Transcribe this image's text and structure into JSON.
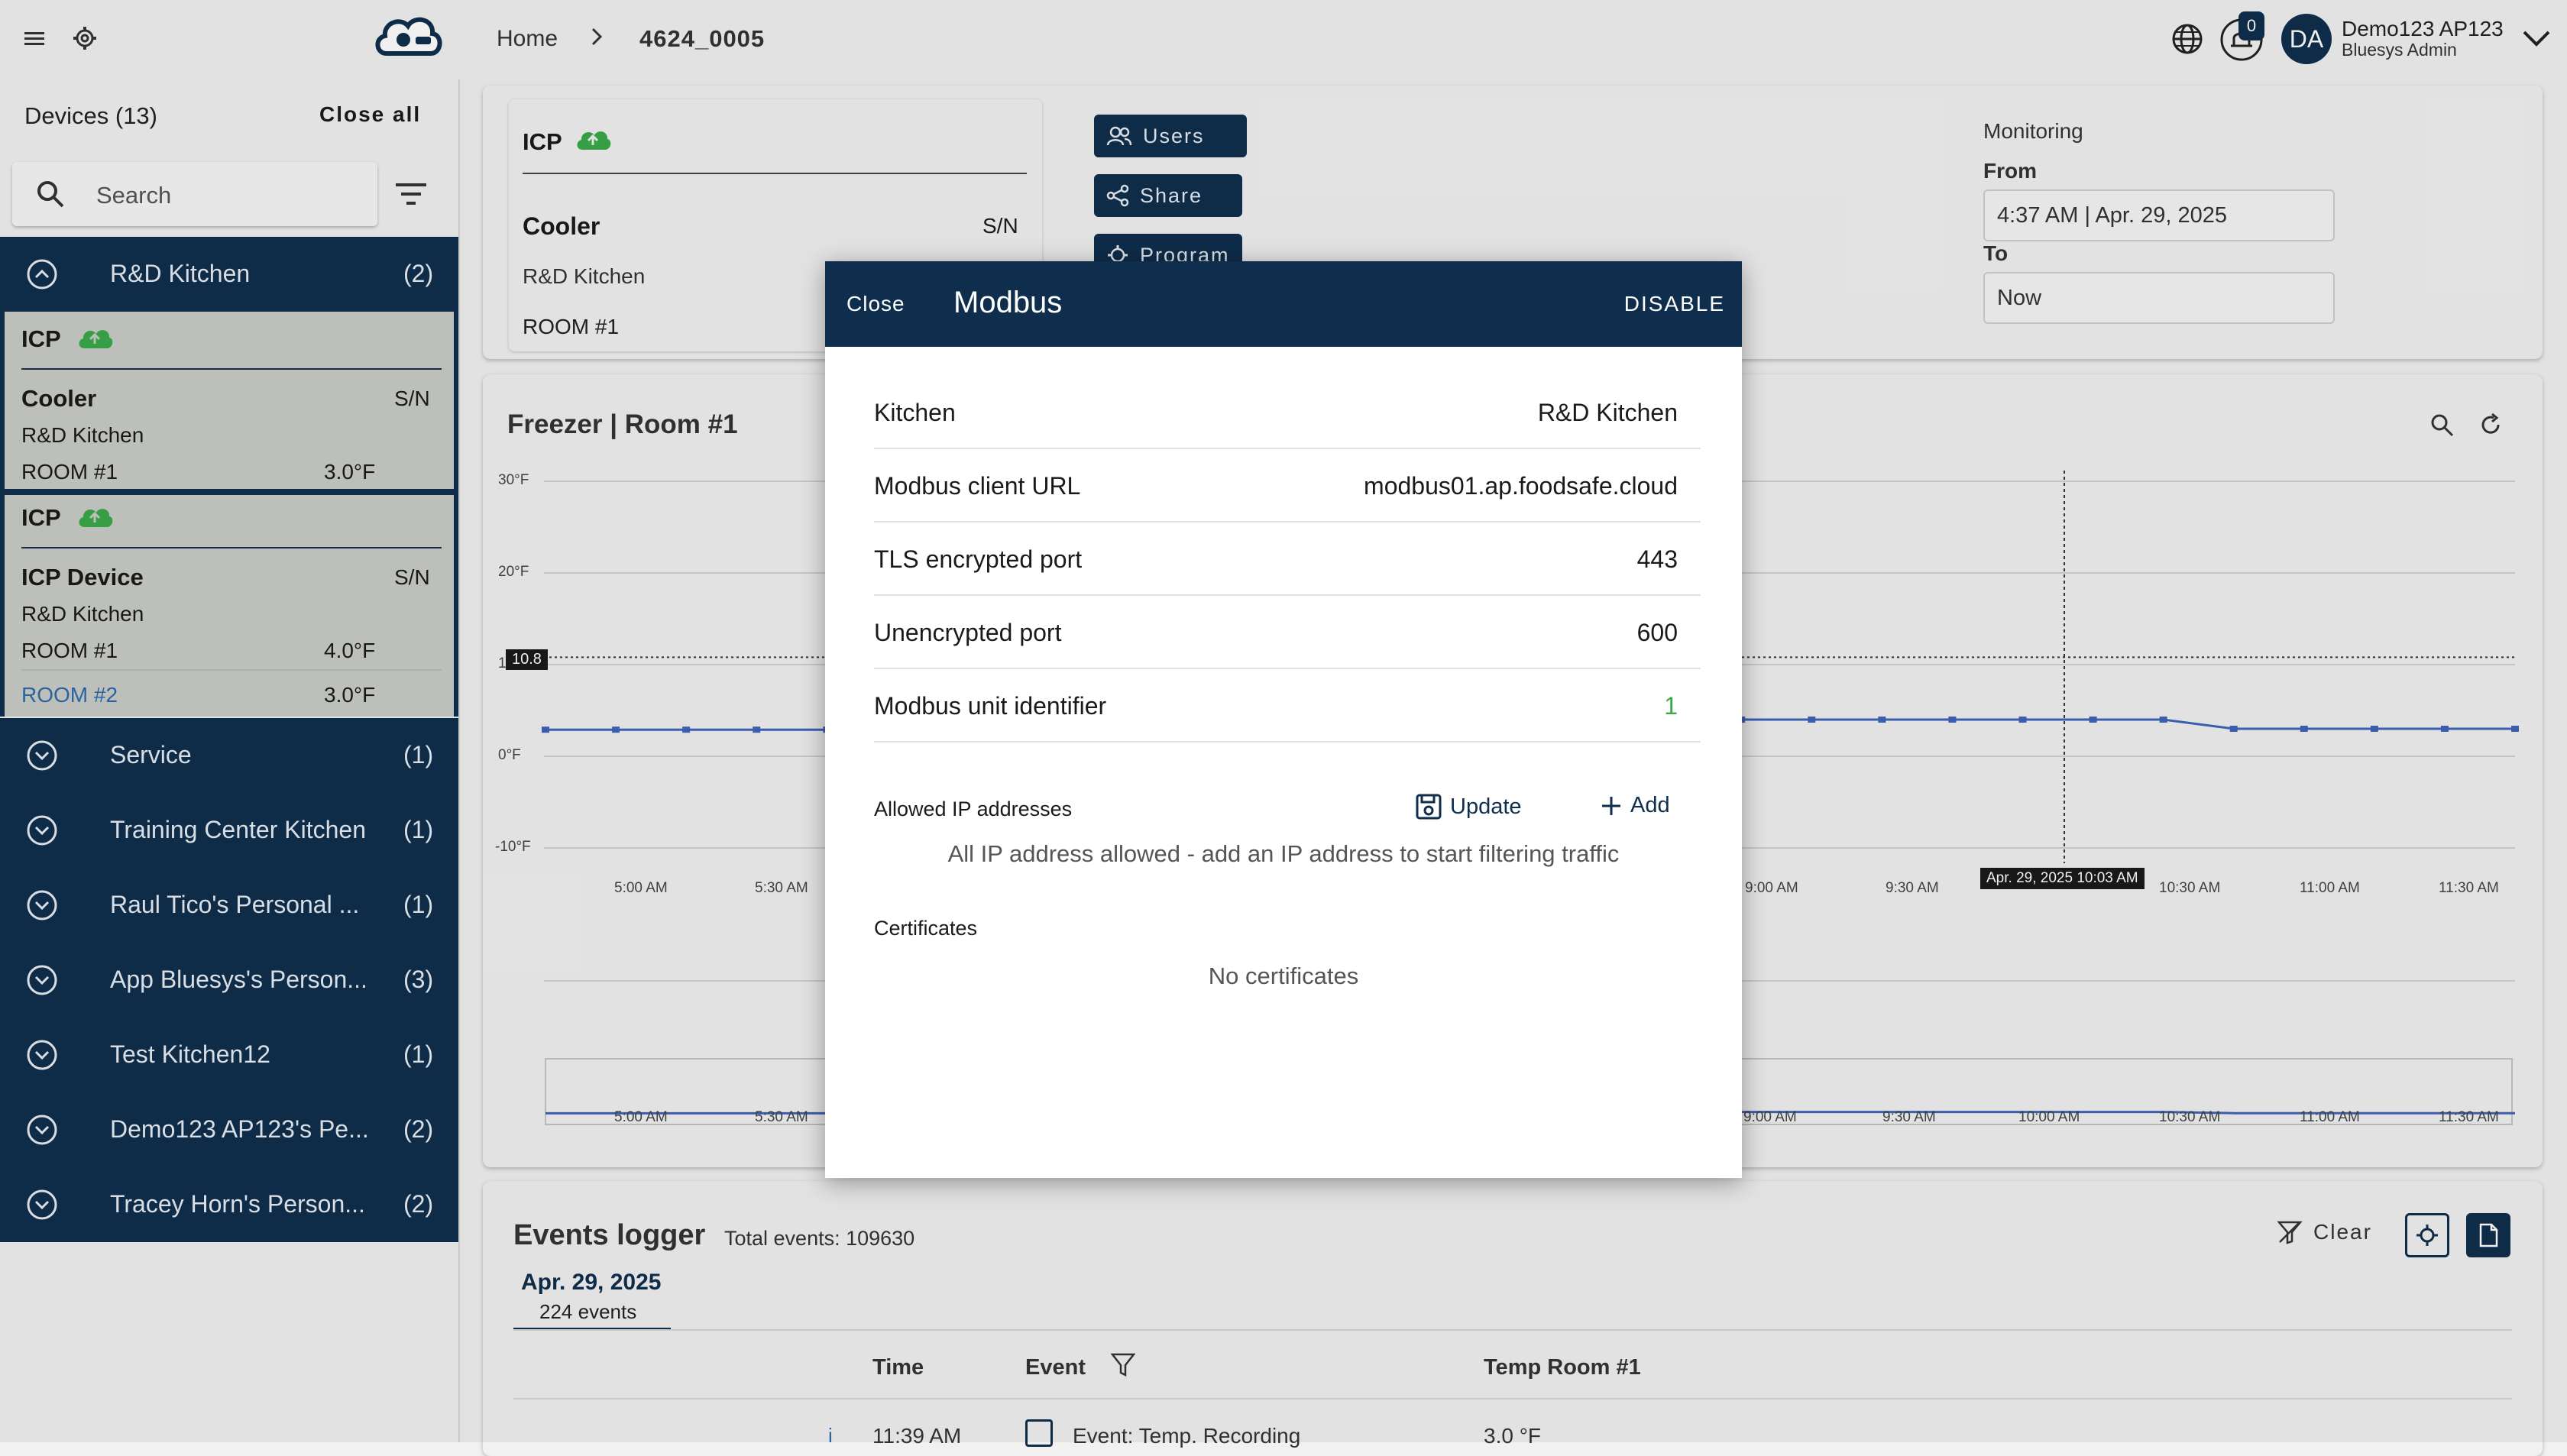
{
  "header": {
    "breadcrumb_home": "Home",
    "breadcrumb_current": "4624_0005",
    "notification_count": "0",
    "avatar_initials": "DA",
    "user_name": "Demo123 AP123",
    "user_role": "Bluesys Admin"
  },
  "sidebar": {
    "devices_title": "Devices (13)",
    "close_all": "Close all",
    "search_placeholder": "Search",
    "expanded_group": {
      "name": "R&D Kitchen",
      "count": "(2)"
    },
    "device1": {
      "type": "ICP",
      "name": "Cooler",
      "sn": "S/N",
      "kitchen": "R&D Kitchen",
      "rooms": [
        {
          "name": "ROOM #1",
          "temp": "3.0°F"
        }
      ]
    },
    "device2": {
      "type": "ICP",
      "name": "ICP Device",
      "sn": "S/N",
      "kitchen": "R&D Kitchen",
      "rooms": [
        {
          "name": "ROOM #1",
          "temp": "4.0°F"
        },
        {
          "name": "ROOM #2",
          "temp": "3.0°F"
        }
      ]
    },
    "groups": [
      {
        "name": "Service",
        "count": "(1)"
      },
      {
        "name": "Training Center Kitchen",
        "count": "(1)"
      },
      {
        "name": "Raul Tico's Personal ...",
        "count": "(1)"
      },
      {
        "name": "App Bluesys's Person...",
        "count": "(3)"
      },
      {
        "name": "Test Kitchen12",
        "count": "(1)"
      },
      {
        "name": "Demo123 AP123's Pe...",
        "count": "(2)"
      },
      {
        "name": "Tracey Horn's Person...",
        "count": "(2)"
      }
    ]
  },
  "info_panel": {
    "type": "ICP",
    "name": "Cooler",
    "sn": "S/N",
    "kitchen": "R&D Kitchen",
    "room": "ROOM #1",
    "buttons": {
      "users": "Users",
      "share": "Share",
      "program": "Program"
    },
    "monitoring": "Monitoring",
    "from_label": "From",
    "from_value": "4:37 AM | Apr. 29, 2025",
    "to_label": "To",
    "to_value": "Now"
  },
  "chart_data": {
    "type": "line",
    "title": "Freezer | Room #1",
    "y_ticks": [
      "30°F",
      "20°F",
      "10°F",
      "0°F",
      "-10°F"
    ],
    "ylim": [
      -10,
      30
    ],
    "x_ticks_main": [
      "5:00 AM",
      "5:30 AM",
      "9:00 AM",
      "9:30 AM",
      "10:30 AM",
      "11:00 AM",
      "11:30 AM"
    ],
    "x_ticks_overview": [
      "5:00 AM",
      "5:30 AM",
      "9:00 AM",
      "9:30 AM",
      "10:00 AM",
      "10:30 AM",
      "11:00 AM",
      "11:30 AM"
    ],
    "threshold_label": "10.8",
    "crosshair_label": "Apr. 29, 2025 10:03 AM",
    "series": [
      {
        "values": [
          2.9,
          2.9,
          2.9,
          2.9,
          2.9,
          2.9,
          2.9,
          6.3,
          6.0,
          6.0,
          4.9,
          4.9,
          4.9,
          4.9,
          4.0,
          4.0,
          4.0,
          4.0,
          4.0,
          4.0,
          4.0,
          4.0,
          4.0,
          4.0,
          3.0,
          3.0,
          3.0,
          3.0,
          3.0
        ]
      }
    ]
  },
  "events": {
    "title": "Events logger",
    "total": "Total events: 109630",
    "clear": "Clear",
    "date_tab": "Apr. 29, 2025",
    "date_events": "224 events",
    "columns": {
      "time": "Time",
      "event": "Event",
      "temp": "Temp Room #1"
    },
    "first_row": {
      "time": "11:39 AM",
      "event": "Event: Temp. Recording",
      "temp": "3.0 °F"
    }
  },
  "modal": {
    "close": "Close",
    "title": "Modbus",
    "disable": "DISABLE",
    "rows": [
      {
        "key": "Kitchen",
        "value": "R&D Kitchen"
      },
      {
        "key": "Modbus client URL",
        "value": "modbus01.ap.foodsafe.cloud"
      },
      {
        "key": "TLS encrypted port",
        "value": "443"
      },
      {
        "key": "Unencrypted port",
        "value": "600"
      },
      {
        "key": "Modbus unit identifier",
        "value": "1"
      }
    ],
    "ip_label": "Allowed IP addresses",
    "update": "Update",
    "add": "Add",
    "ip_msg": "All IP address allowed - add an IP address to start filtering traffic",
    "certs_label": "Certificates",
    "certs_msg": "No certificates",
    "accent_green": "#3aa84a"
  }
}
